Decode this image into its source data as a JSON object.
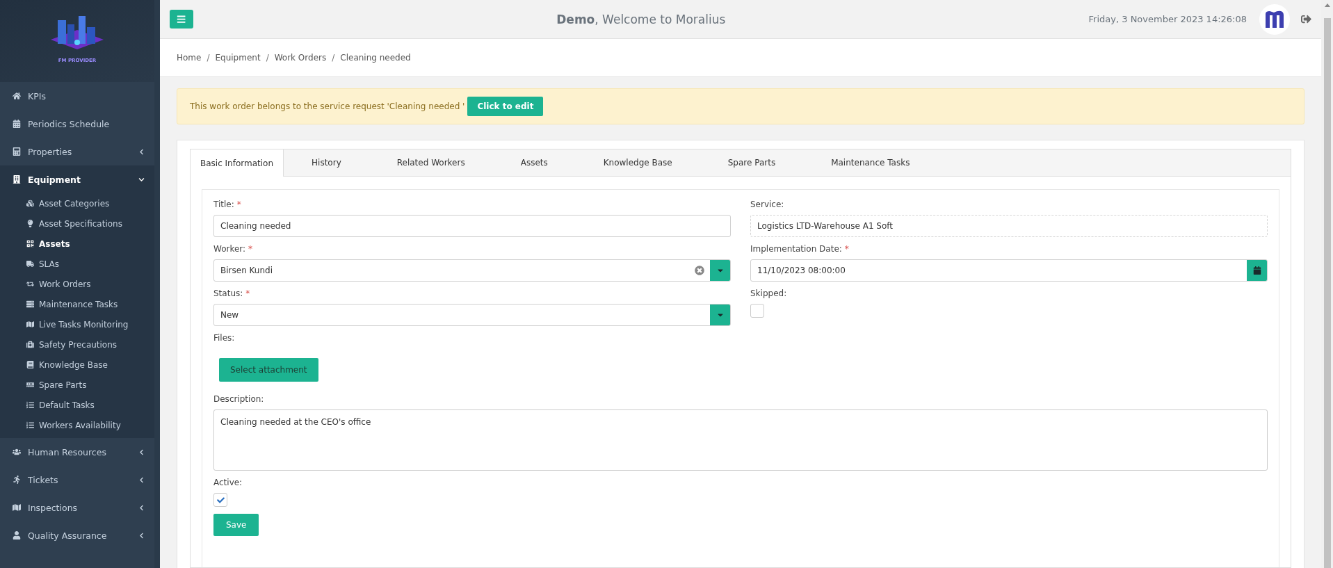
{
  "header": {
    "user": "Demo",
    "welcome": ", Welcome to Moralius",
    "datetime": "Friday, 3 November 2023 14:26:08"
  },
  "sidebar": {
    "logo_caption": "FM PROVIDER",
    "items": [
      {
        "label": "KPIs",
        "selected": false
      },
      {
        "label": "Periodics Schedule",
        "selected": false
      },
      {
        "label": "Properties",
        "expanded": false,
        "selected": false
      },
      {
        "label": "Equipment",
        "expanded": true,
        "selected": true,
        "children": [
          {
            "label": "Asset Categories",
            "selected": false
          },
          {
            "label": "Asset Specifications",
            "selected": false
          },
          {
            "label": "Assets",
            "selected": true
          },
          {
            "label": "SLAs",
            "selected": false
          },
          {
            "label": "Work Orders",
            "selected": false
          },
          {
            "label": "Maintenance Tasks",
            "selected": false
          },
          {
            "label": "Live Tasks Monitoring",
            "selected": false
          },
          {
            "label": "Safety Precautions",
            "selected": false
          },
          {
            "label": "Knowledge Base",
            "selected": false
          },
          {
            "label": "Spare Parts",
            "selected": false
          },
          {
            "label": "Default Tasks",
            "selected": false
          },
          {
            "label": "Workers Availability",
            "selected": false
          }
        ]
      },
      {
        "label": "Human Resources",
        "expanded": false,
        "selected": false
      },
      {
        "label": "Tickets",
        "expanded": false,
        "selected": false
      },
      {
        "label": "Inspections",
        "expanded": false,
        "selected": false
      },
      {
        "label": "Quality Assurance",
        "expanded": false,
        "selected": false
      }
    ]
  },
  "breadcrumbs": [
    "Home",
    "Equipment",
    "Work Orders",
    "Cleaning needed"
  ],
  "breadcrumb_separator": "/",
  "alert": {
    "text": "This work order belongs to the service request 'Cleaning needed '",
    "button": "Click to edit"
  },
  "tabs": [
    {
      "label": "Basic Information",
      "selected": true
    },
    {
      "label": "History",
      "selected": false
    },
    {
      "label": "Related Workers",
      "selected": false
    },
    {
      "label": "Assets",
      "selected": false
    },
    {
      "label": "Knowledge Base",
      "selected": false
    },
    {
      "label": "Spare Parts",
      "selected": false
    },
    {
      "label": "Maintenance Tasks",
      "selected": false
    }
  ],
  "form": {
    "required_mark": "*",
    "left": [
      {
        "kind": "text",
        "label": "Title:",
        "required": true,
        "value": "Cleaning needed"
      },
      {
        "kind": "select",
        "label": "Worker:",
        "required": true,
        "value": "Birsen Kundi",
        "clearable": true
      },
      {
        "kind": "select",
        "label": "Status:",
        "required": true,
        "value": "New",
        "clearable": false
      },
      {
        "kind": "file",
        "label": "Files:",
        "required": false,
        "button": "Select attachment"
      }
    ],
    "right": [
      {
        "kind": "readonly",
        "label": "Service:",
        "required": false,
        "value": "Logistics LTD-Warehouse A1 Soft"
      },
      {
        "kind": "date",
        "label": "Implementation Date:",
        "required": true,
        "value": "11/10/2023 08:00:00"
      },
      {
        "kind": "checkbox",
        "label": "Skipped:",
        "required": false,
        "checked": false
      }
    ],
    "full": [
      {
        "kind": "textarea",
        "label": "Description:",
        "required": false,
        "value": "Cleaning needed at the CEO's office"
      },
      {
        "kind": "checkbox",
        "label": "Active:",
        "required": false,
        "checked": true
      }
    ],
    "save": "Save"
  }
}
